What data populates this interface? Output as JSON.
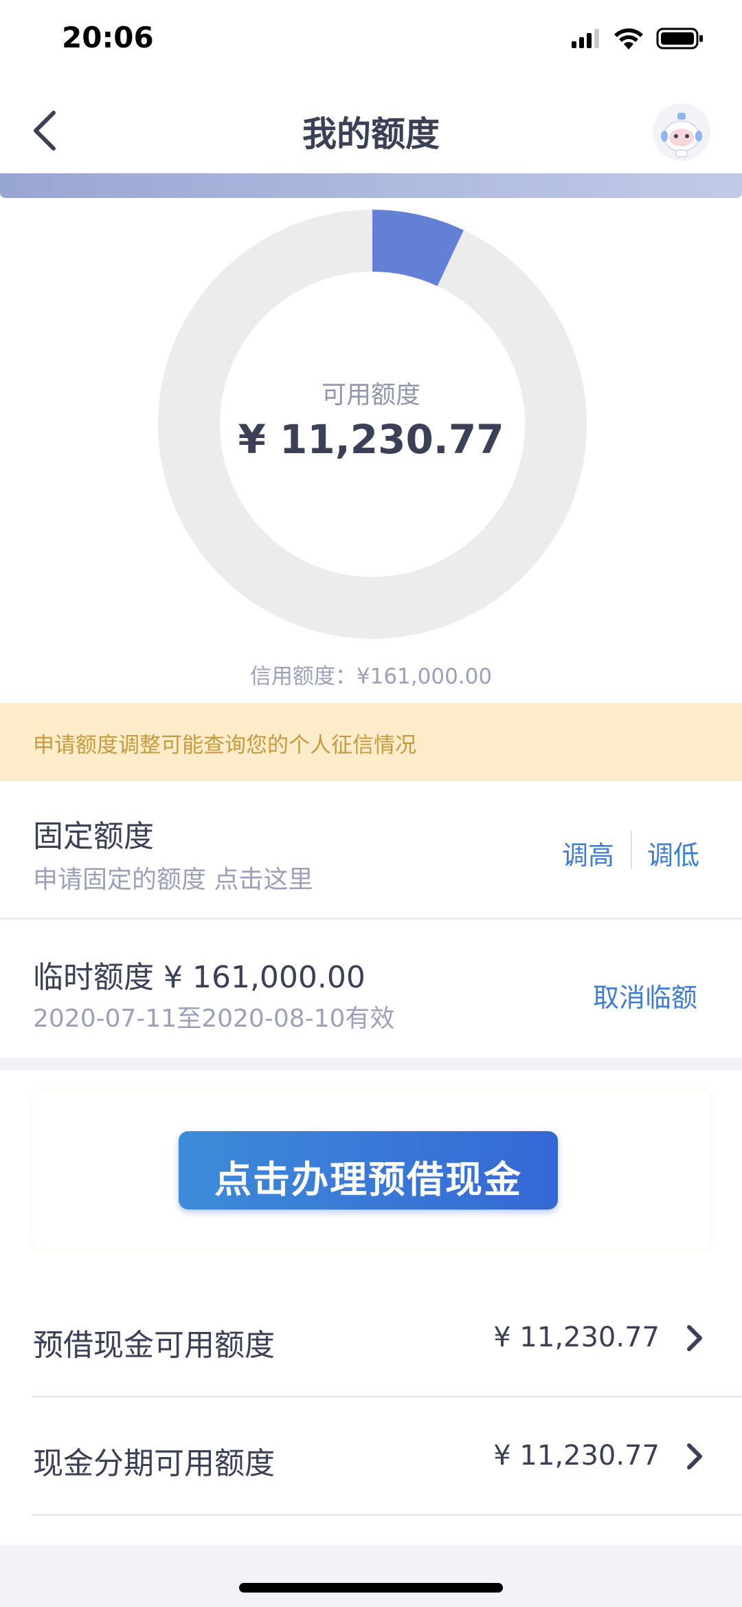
{
  "status_bar": {
    "time": "20:06"
  },
  "nav": {
    "title": "我的额度",
    "back_icon": "chevron-left-icon",
    "avatar_icon": "robot-mascot-icon"
  },
  "donut": {
    "label": "可用额度",
    "value": "¥ 11,230.77",
    "used_fraction": 0.07,
    "used_color": "#6180d6",
    "track_color": "#ececec"
  },
  "credit_limit": "信用额度：¥161,000.00",
  "notice": "申请额度调整可能查询您的个人征信情况",
  "fixed_quota": {
    "title": "固定额度",
    "subtitle": "申请固定的额度 点击这里",
    "raise_label": "调高",
    "lower_label": "调低"
  },
  "temp_quota": {
    "title": "临时额度 ¥ 161,000.00",
    "validity": "2020-07-11至2020-08-10有效",
    "cancel_label": "取消临额"
  },
  "banner": {
    "button_label": "点击办理预借现金"
  },
  "list": [
    {
      "label": "预借现金可用额度",
      "value": "¥ 11,230.77"
    },
    {
      "label": "现金分期可用额度",
      "value": "¥ 11,230.77"
    }
  ],
  "colors": {
    "accent": "#3e7cd6",
    "notice_bg": "#fcecc9",
    "notice_text": "#c79a3d"
  }
}
